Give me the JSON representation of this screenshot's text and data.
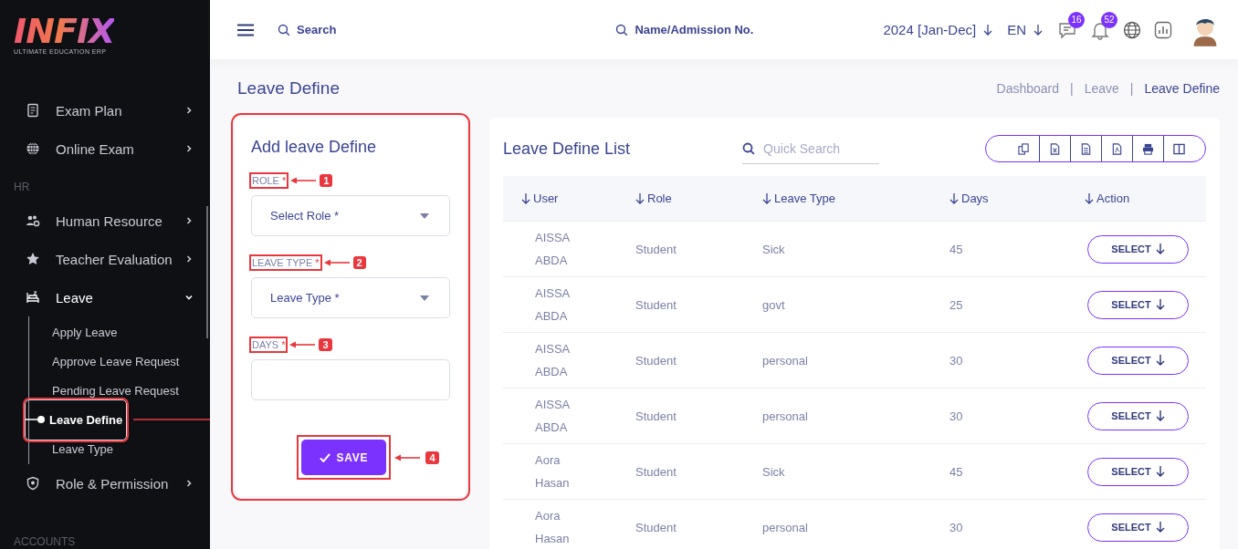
{
  "sidebar": {
    "logo": {
      "name": "INFIX",
      "tagline": "ULTIMATE EDUCATION ERP"
    },
    "items": [
      {
        "kind": "item",
        "label": "Exam Plan",
        "expanded": false
      },
      {
        "kind": "item",
        "label": "Online Exam",
        "expanded": false
      },
      {
        "kind": "heading",
        "label": "HR"
      },
      {
        "kind": "item",
        "label": "Human Resource",
        "expanded": false
      },
      {
        "kind": "item",
        "label": "Teacher Evaluation",
        "expanded": false
      },
      {
        "kind": "item",
        "label": "Leave",
        "expanded": true,
        "children": [
          {
            "label": "Apply Leave",
            "selected": false
          },
          {
            "label": "Approve Leave Request",
            "selected": false
          },
          {
            "label": "Pending Leave Request",
            "selected": false
          },
          {
            "label": "Leave Define",
            "selected": true,
            "callout": true
          },
          {
            "label": "Leave Type",
            "selected": false
          }
        ]
      },
      {
        "kind": "item",
        "label": "Role & Permission",
        "expanded": false
      },
      {
        "kind": "heading",
        "label": "ACCOUNTS"
      }
    ]
  },
  "topbar": {
    "search": "Search",
    "student_search": "Name/Admission No.",
    "session": "2024 [Jan-Dec]",
    "language": "EN",
    "message_count": "16",
    "notification_count": "52"
  },
  "page_title": "Leave Define",
  "breadcrumb_separator": "|",
  "breadcrumb": [
    {
      "label": "Dashboard",
      "selected": false
    },
    {
      "label": "Leave",
      "selected": false
    },
    {
      "label": "Leave Define",
      "selected": true
    }
  ],
  "form": {
    "title": "Add leave Define",
    "fields": [
      {
        "kind": "select",
        "label": "ROLE",
        "required": "*",
        "placeholder": "Select Role *",
        "callout": "1"
      },
      {
        "kind": "select",
        "label": "LEAVE TYPE",
        "required": "*",
        "placeholder": "Leave Type *",
        "callout": "2"
      },
      {
        "kind": "input",
        "label": "DAYS",
        "required": "*",
        "callout": "3"
      }
    ],
    "save": {
      "label": "SAVE",
      "callout": "4"
    }
  },
  "list": {
    "title": "Leave Define List",
    "search_placeholder": "Quick Search",
    "columns": [
      "User",
      "Role",
      "Leave Type",
      "Days",
      "Action"
    ],
    "rows": [
      {
        "user": "AISSA ABDA",
        "role": "Student",
        "leave_type": "Sick",
        "days": "45",
        "action": "SELECT"
      },
      {
        "user": "AISSA ABDA",
        "role": "Student",
        "leave_type": "govt",
        "days": "25",
        "action": "SELECT"
      },
      {
        "user": "AISSA ABDA",
        "role": "Student",
        "leave_type": "personal",
        "days": "30",
        "action": "SELECT"
      },
      {
        "user": "AISSA ABDA",
        "role": "Student",
        "leave_type": "personal",
        "days": "30",
        "action": "SELECT"
      },
      {
        "user": "Aora Hasan",
        "role": "Student",
        "leave_type": "Sick",
        "days": "45",
        "action": "SELECT"
      },
      {
        "user": "Aora Hasan",
        "role": "Student",
        "leave_type": "personal",
        "days": "30",
        "action": "SELECT"
      }
    ]
  }
}
